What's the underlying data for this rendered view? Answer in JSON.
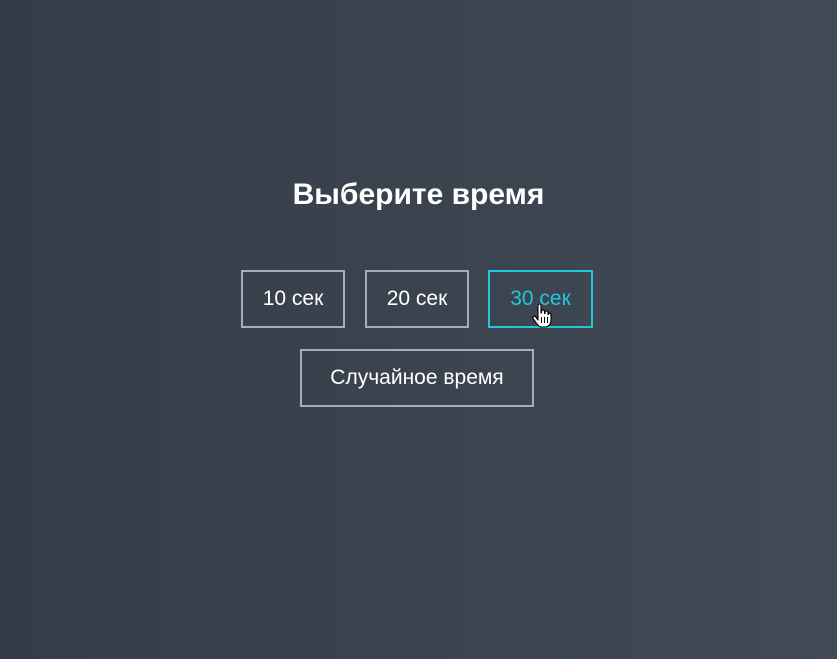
{
  "header": {
    "title": "Выберите время"
  },
  "options": [
    {
      "label": "10 сек",
      "selected": false
    },
    {
      "label": "20 сек",
      "selected": false
    },
    {
      "label": "30 сек",
      "selected": true
    }
  ],
  "random": {
    "label": "Случайное время"
  },
  "colors": {
    "accent": "#22c6dd",
    "border": "#a7adb5",
    "text": "#ffffff",
    "background": "#3a434e"
  },
  "cursor": {
    "icon": "hand-pointer-icon"
  }
}
